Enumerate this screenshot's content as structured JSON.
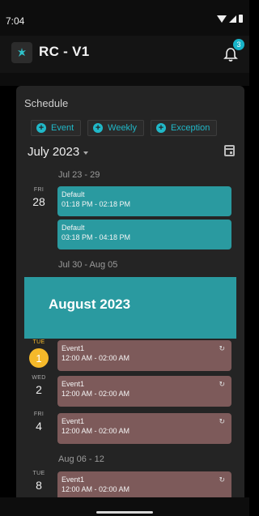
{
  "status_bar": {
    "time": "7:04"
  },
  "app_bar": {
    "title": "RC - V1",
    "notification_count": "3"
  },
  "schedule": {
    "title": "Schedule",
    "actions": [
      {
        "label": "Event"
      },
      {
        "label": "Weekly"
      },
      {
        "label": "Exception"
      }
    ],
    "month_select": "July 2023",
    "weeks": [
      {
        "label": "Jul 23 - 29"
      },
      {
        "label": "Jul 30 - Aug 05"
      },
      {
        "label": "Aug 06 - 12"
      }
    ],
    "days": [
      {
        "dow": "FRI",
        "num": "28"
      },
      {
        "dow": "TUE",
        "num": "1"
      },
      {
        "dow": "WED",
        "num": "2"
      },
      {
        "dow": "FRI",
        "num": "4"
      },
      {
        "dow": "TUE",
        "num": "8"
      }
    ],
    "events": [
      {
        "title": "Default",
        "time": "01:18 PM - 02:18 PM"
      },
      {
        "title": "Default",
        "time": "03:18 PM - 04:18 PM"
      },
      {
        "title": "Event1",
        "time": "12:00 AM - 02:00 AM"
      },
      {
        "title": "Event1",
        "time": "12:00 AM - 02:00 AM"
      },
      {
        "title": "Event1",
        "time": "12:00 AM - 02:00 AM"
      },
      {
        "title": "Event1",
        "time": "12:00 AM - 02:00 AM"
      }
    ],
    "month_banner": "August 2023"
  },
  "colors": {
    "accent": "#20b8c8",
    "event_default": "#2a9aa0",
    "event_recurring": "#7d5a5a",
    "today": "#f5b92a"
  }
}
